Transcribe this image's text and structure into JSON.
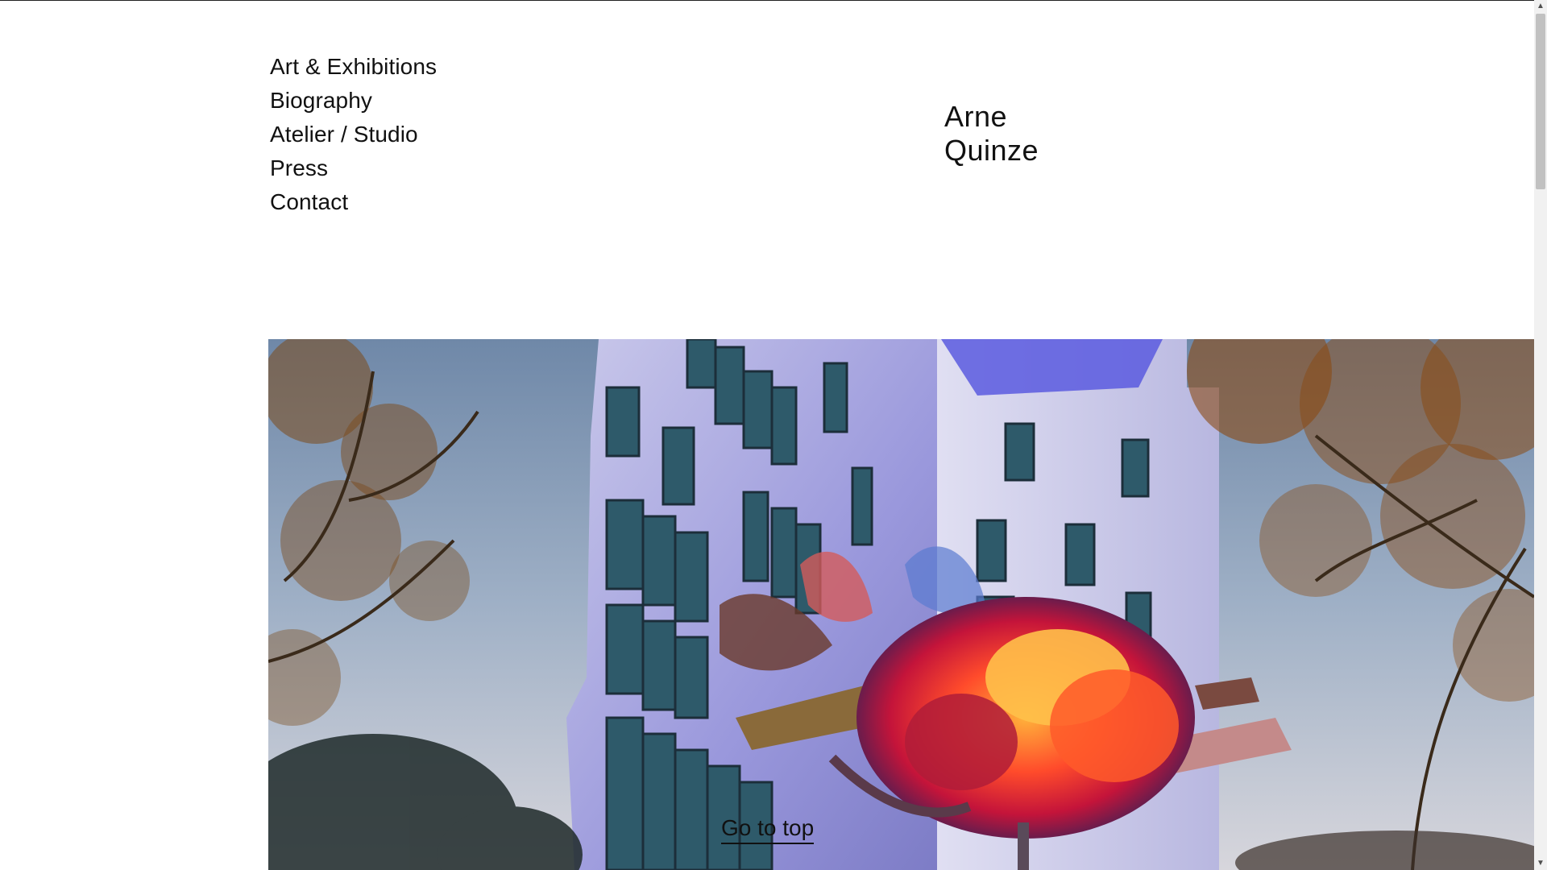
{
  "nav": {
    "items": [
      {
        "label": "Art & Exhibitions"
      },
      {
        "label": "Biography"
      },
      {
        "label": "Atelier / Studio"
      },
      {
        "label": "Press"
      },
      {
        "label": "Contact"
      }
    ]
  },
  "logo": {
    "line1": "Arne",
    "line2": "Quinze"
  },
  "hero": {
    "link_label": "Go to top"
  },
  "scrollbar": {
    "up_icon": "▲",
    "down_icon": "▼"
  },
  "colors": {
    "text": "#111111",
    "background": "#ffffff",
    "scrollbar_track": "#f1f1f1",
    "scrollbar_thumb": "#c1c1c1"
  }
}
